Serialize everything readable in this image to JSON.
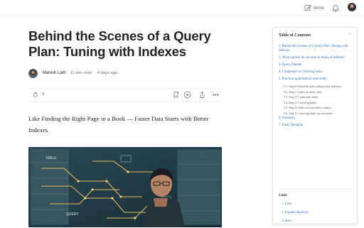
{
  "topbar": {
    "write_label": "Write"
  },
  "article": {
    "title": "Behind the Scenes of a Query Plan: Tuning with Indexes",
    "author": "Manish Lath",
    "read_time": "11 min read",
    "date": "4 days ago",
    "clap_count": "9",
    "subtitle": "Like Finding the Right Page in a Book — Faster Data Starts with Better Indexes",
    "hero_labels": {
      "table": "TABLE",
      "query": "QUERY"
    }
  },
  "toc": {
    "heading": "Table of Contents",
    "collapse_symbol": "−",
    "items": [
      {
        "label": "1. Behind the Scenes of a Query Plan: Tuning with Indexes",
        "subs": []
      },
      {
        "label": "2. What options do we have in terms of indexes?",
        "subs": []
      },
      {
        "label": "3. Query Planner",
        "subs": []
      },
      {
        "label": "4. Composite vs Covering index",
        "subs": []
      },
      {
        "label": "5. Practical optimisation case study",
        "subs": [
          "5.1. Step 0: Baseline (only primary key indexes)",
          "5.2. Step 1: Index on order_date",
          "5.3. Step 2: Composite Index",
          "5.4. Step 3: Covering Index",
          "5.5. Step 4: Index on customers country",
          "5.6. Step 5: Covering index on customers"
        ]
      },
      {
        "label": "6. Summary",
        "subs": []
      },
      {
        "label": "7. Final Thoughts",
        "subs": []
      }
    ],
    "links_heading": "Links",
    "links": [
      "1. Lists",
      "2. Explain Analysis",
      "3. docs"
    ]
  },
  "colors": {
    "link": "#2a6fb5",
    "text": "#242424",
    "muted": "#6b6b6b"
  },
  "icons": [
    "write-icon",
    "bell-icon",
    "clap-icon",
    "comment-icon",
    "bookmark-icon",
    "play-icon",
    "share-icon",
    "more-icon"
  ]
}
